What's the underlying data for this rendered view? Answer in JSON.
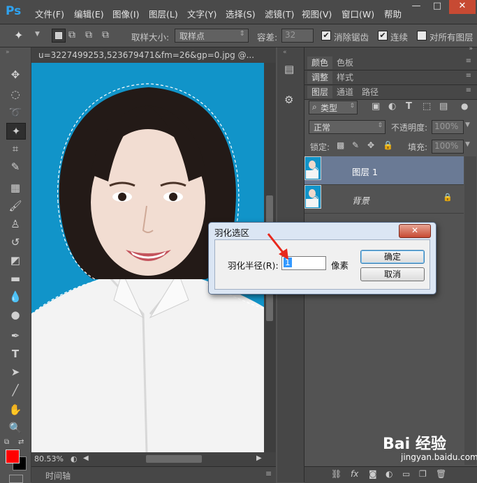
{
  "app": {
    "logo": "Ps"
  },
  "menu": [
    "文件(F)",
    "编辑(E)",
    "图像(I)",
    "图层(L)",
    "文字(Y)",
    "选择(S)",
    "滤镜(T)",
    "视图(V)",
    "窗口(W)",
    "帮助"
  ],
  "window_controls": {
    "minimize": "—",
    "restore": "□",
    "close": "✕"
  },
  "options": {
    "sample_size_label": "取样大小:",
    "sample_size_value": "取样点",
    "tolerance_label": "容差:",
    "tolerance_value": "32",
    "antialias_label": "消除锯齿",
    "contiguous_label": "连续",
    "all_layers_label": "对所有图层"
  },
  "document": {
    "tab_title": "u=3227499253,523679471&fm=26&gp=0.jpg @...",
    "zoom": "80.53%",
    "timeline_label": "时间轴"
  },
  "panels": {
    "group1_tabs": [
      "颜色",
      "色板"
    ],
    "group2_tabs": [
      "调整",
      "样式"
    ],
    "layers_tabs": [
      "图层",
      "通道",
      "路径"
    ],
    "filter_kind": "类型",
    "blend_mode": "正常",
    "opacity_label": "不透明度:",
    "opacity_value": "100%",
    "lock_label": "锁定:",
    "fill_label": "填充:",
    "fill_value": "100%",
    "layers": [
      {
        "name": "图层 1",
        "selected": true
      },
      {
        "name": "背景",
        "selected": false,
        "locked": true
      }
    ]
  },
  "dialog": {
    "title": "羽化选区",
    "radius_label": "羽化半径(R):",
    "radius_value": "1",
    "unit": "像素",
    "ok": "确定",
    "cancel": "取消"
  },
  "colors": {
    "foreground": "#ff0000",
    "background": "#000000",
    "canvas_bg": "#1194c9"
  },
  "watermark": {
    "text": "Bai 经验",
    "url": "jingyan.baidu.com"
  }
}
